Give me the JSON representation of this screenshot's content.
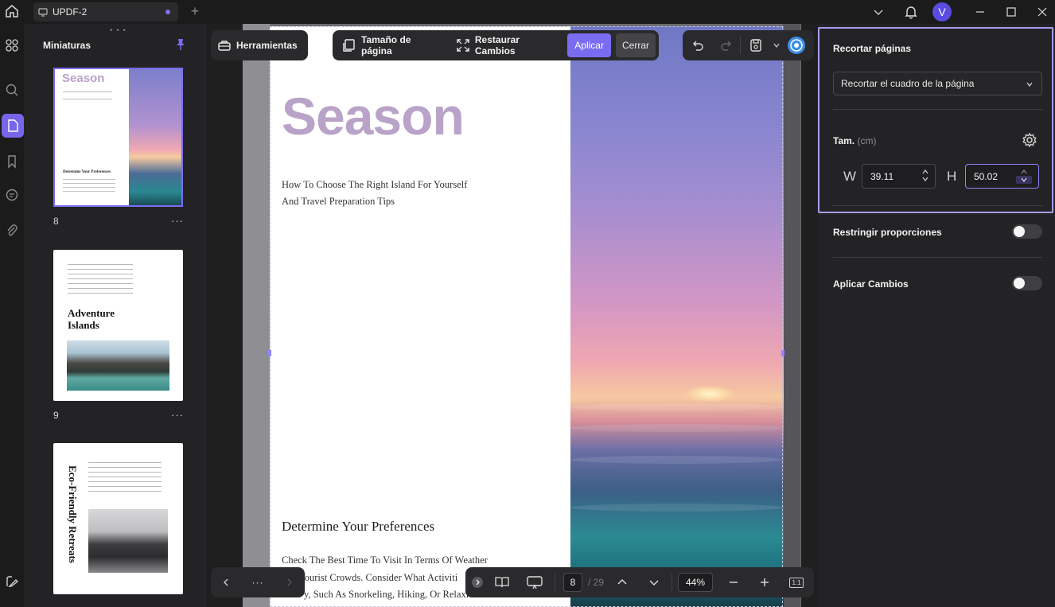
{
  "titlebar": {
    "tab_title": "UPDF-2",
    "new_tab_symbol": "+",
    "avatar_letter": "V",
    "accent_color": "#7a6cf0"
  },
  "rail": {
    "icons": [
      "apps-icon",
      "search-icon",
      "pages-icon",
      "bookmark-icon",
      "comment-icon",
      "attachment-icon",
      "layers-icon"
    ]
  },
  "thumbnails": {
    "title": "Miniaturas",
    "items": [
      {
        "page": "8",
        "title": "Season",
        "heading": "Determine Your Preferences"
      },
      {
        "page": "9",
        "title": "Adventure Islands"
      },
      {
        "page": "",
        "title": "Eco-Friendly Retreats"
      }
    ]
  },
  "toolbar": {
    "tools_label": "Herramientas",
    "page_size_label": "Tamaño de página",
    "restore_label": "Restaurar Cambios",
    "apply_label": "Aplicar",
    "close_label": "Cerrar"
  },
  "document": {
    "title": "Season",
    "subtitle_line1": "How To Choose The Right Island For Yourself",
    "subtitle_line2": "And Travel Preparation Tips",
    "section_heading": "Determine Your Preferences",
    "para_line1": "Check The Best Time To Visit In Terms Of Weather",
    "para_line2": "Tourist Crowds. Consider What Activiti",
    "para_line3": "y, Such As Snorkeling, Hiking, Or Relaxi"
  },
  "navigation": {
    "more_label": "···",
    "current_page": "8",
    "total_pages": "/ 29",
    "zoom": "44%",
    "fit_label": "1:1"
  },
  "right_panel": {
    "title": "Recortar páginas",
    "crop_mode": "Recortar el cuadro de la página",
    "size_label": "Tam.",
    "size_unit": "(cm)",
    "width_label": "W",
    "width_value": "39.11",
    "height_label": "H",
    "height_value": "50.02",
    "constrain_label": "Restringir proporciones",
    "apply_changes_label": "Aplicar Cambios"
  }
}
